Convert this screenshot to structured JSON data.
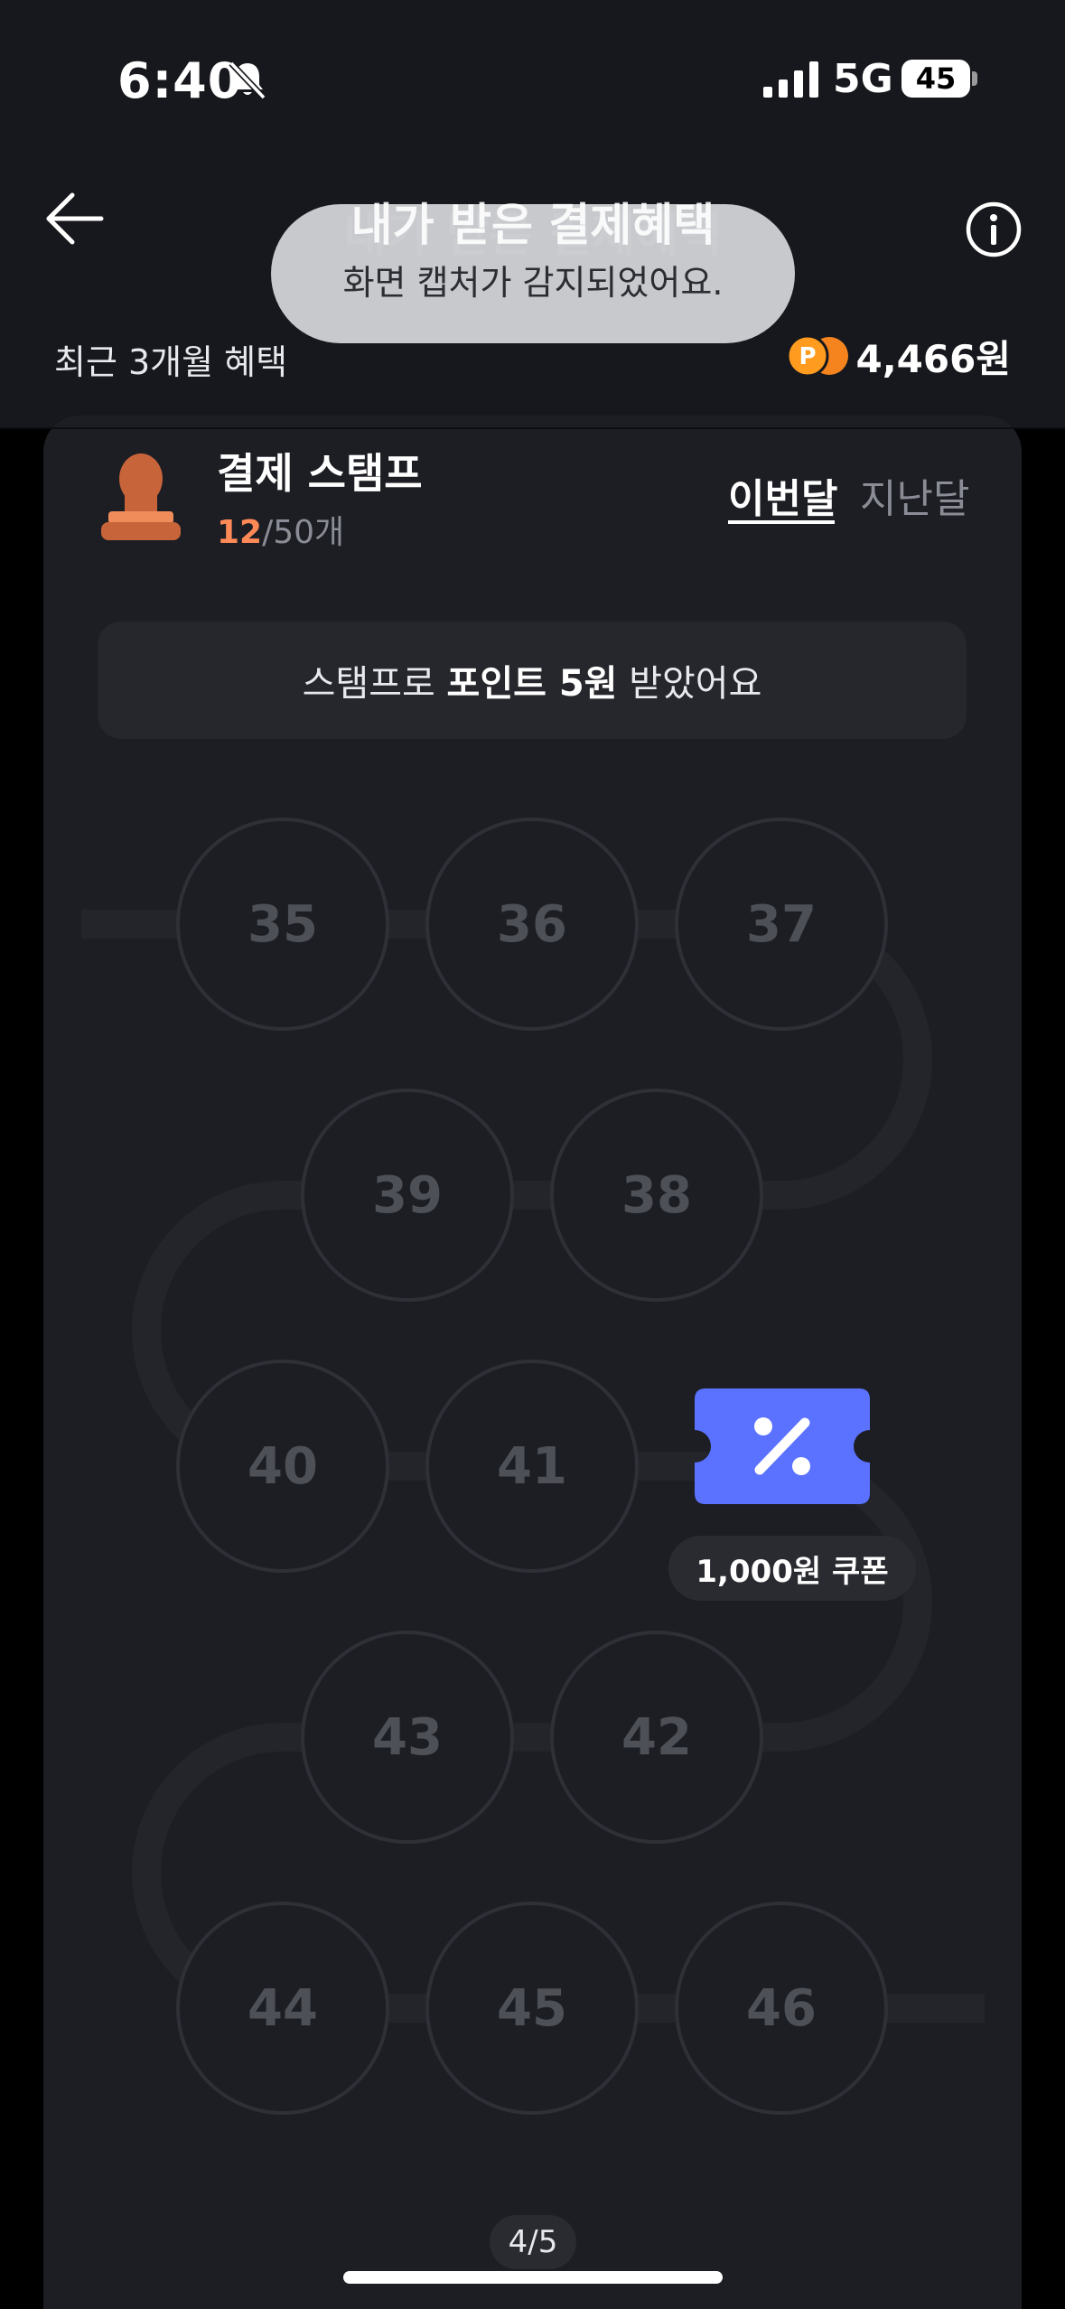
{
  "status_bar": {
    "time": "6:40",
    "network": "5G",
    "battery": "45",
    "icons": [
      "bell-slash-icon",
      "signal-icon"
    ]
  },
  "header": {
    "title": "내가 받은 결제혜택",
    "benefit_label": "최근 3개월 혜택",
    "benefit_amount": "4,466원",
    "icons": [
      "back-arrow-icon",
      "info-icon",
      "point-coin-icon"
    ]
  },
  "toast": {
    "message": "화면 캡처가 감지되었어요."
  },
  "stamp_card": {
    "title": "결제 스탬프",
    "count_current": "12",
    "count_total": "/50개",
    "tabs": [
      {
        "label": "이번달",
        "selected": true
      },
      {
        "label": "지난달",
        "selected": false
      }
    ],
    "notice_prefix": "스탬프로 ",
    "notice_bold": "포인트 5원",
    "notice_suffix": " 받았어요"
  },
  "stamps": [
    "35",
    "36",
    "37",
    "38",
    "39",
    "40",
    "41",
    "42",
    "43",
    "44",
    "45",
    "46"
  ],
  "coupon": {
    "label": "1,000원 쿠폰",
    "color": "#5a72ff",
    "icon": "percent-ticket-icon"
  },
  "pagination": {
    "label": "4/5"
  },
  "colors": {
    "accent_orange": "#ff8a57",
    "coupon_blue": "#5a72ff",
    "background": "#17181d",
    "card": "#1d1e24"
  }
}
